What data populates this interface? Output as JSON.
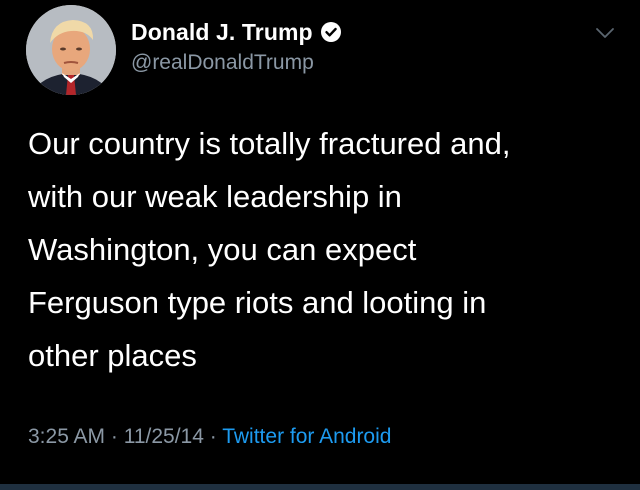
{
  "author": {
    "display_name": "Donald J. Trump",
    "handle": "@realDonaldTrump",
    "verified_icon": "verified-badge-icon",
    "avatar": "avatar-photo"
  },
  "tweet": {
    "text": "Our country is totally fractured and,\nwith our weak leadership in\nWashington, you can expect\nFerguson type riots and looting in\nother places"
  },
  "meta": {
    "time": "3:25 AM",
    "separator": " · ",
    "date": "11/25/14",
    "source": "Twitter for Android"
  },
  "menu": {
    "icon": "chevron-down-icon"
  },
  "colors": {
    "background": "#000000",
    "text": "#ffffff",
    "secondary_text": "#8b98a5",
    "link": "#1d9bf0"
  }
}
